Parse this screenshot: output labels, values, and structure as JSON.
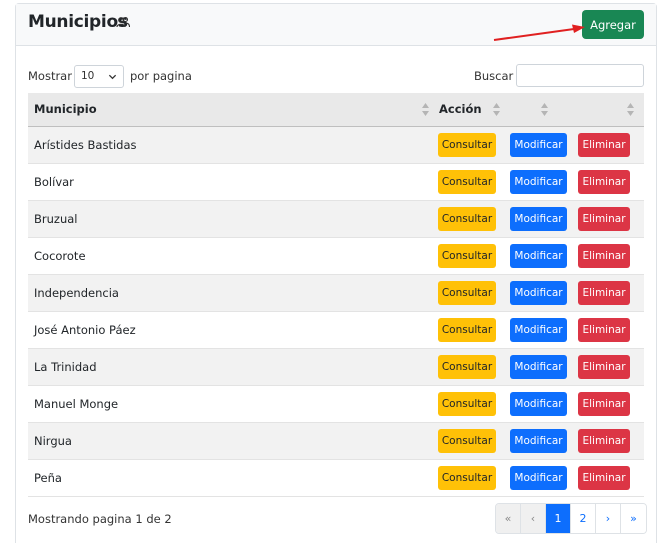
{
  "header": {
    "title": "Municipios",
    "add_label": "Agregar"
  },
  "controls": {
    "show_label": "Mostrar",
    "page_size": "10",
    "per_page_label": "por pagina",
    "search_label": "Buscar",
    "search_value": ""
  },
  "table": {
    "columns": [
      "Municipio",
      "Acción",
      "",
      ""
    ],
    "rows": [
      {
        "name": "Arístides Bastidas"
      },
      {
        "name": "Bolívar"
      },
      {
        "name": "Bruzual"
      },
      {
        "name": "Cocorote"
      },
      {
        "name": "Independencia"
      },
      {
        "name": "José Antonio Páez"
      },
      {
        "name": "La Trinidad"
      },
      {
        "name": "Manuel Monge"
      },
      {
        "name": "Nirgua"
      },
      {
        "name": "Peña"
      }
    ],
    "actions": {
      "consultar": "Consultar",
      "modificar": "Modificar",
      "eliminar": "Eliminar"
    }
  },
  "footer": {
    "info": "Mostrando pagina 1 de 2",
    "pagination": [
      "«",
      "‹",
      "1",
      "2",
      "›",
      "»"
    ]
  },
  "colors": {
    "success": "#198754",
    "warning": "#ffc107",
    "primary": "#0d6efd",
    "danger": "#dc3545",
    "annotation_arrow": "#e02020"
  },
  "icons": {
    "title_icon": "users-icon",
    "sort_icon": "sort-icon",
    "select_icon": "chevron-down-icon"
  }
}
